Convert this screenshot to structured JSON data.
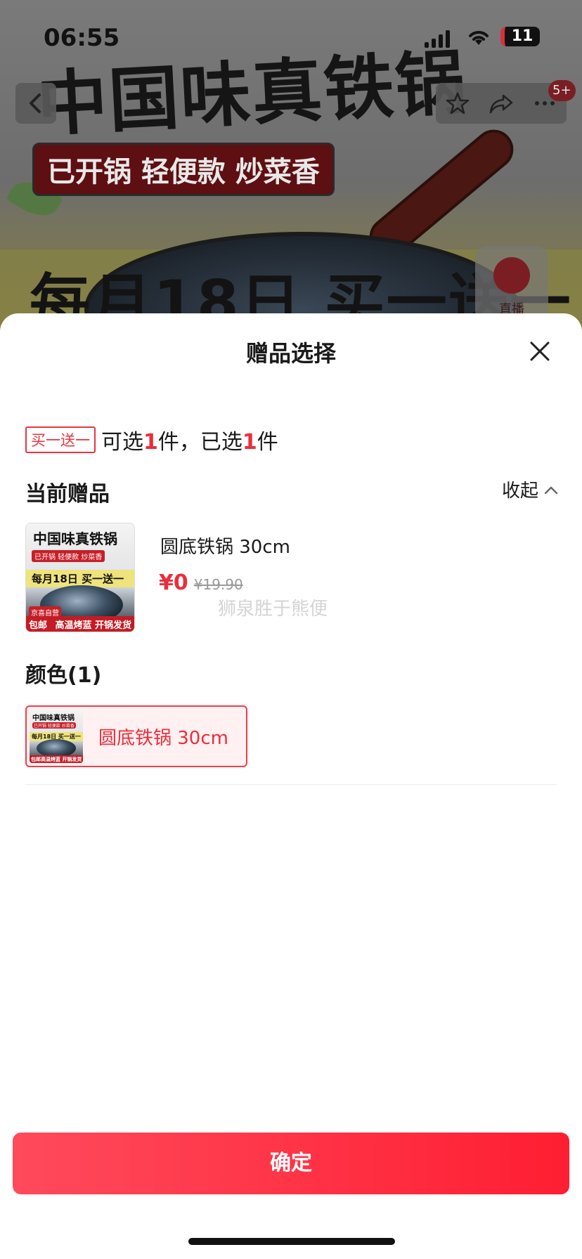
{
  "status_bar": {
    "time": "06:55",
    "battery": "11"
  },
  "background": {
    "hero_title": "中国味真铁锅",
    "hero_tag": "已开锅 轻便款 炒菜香",
    "promo": "每月18日 买一送一",
    "badge": "5+",
    "live_label": "直播"
  },
  "sheet": {
    "title": "赠品选择",
    "gift_tag": "买一送一",
    "gift_info": {
      "prefix": "可选",
      "available": "1",
      "middle": "件，已选",
      "selected": "1",
      "suffix": "件"
    },
    "current_gift_heading": "当前赠品",
    "collapse_label": "收起",
    "product": {
      "name": "圆底铁锅 30cm",
      "price": "¥0",
      "original_price": "¥19.90",
      "thumb": {
        "title": "中国味真铁锅",
        "tag": "已开锅 轻便款 炒菜香",
        "promo": "每月18日 买一送一",
        "corner": "京喜自营",
        "shipping": "包邮",
        "footer": "高温烤蓝 开锅发货"
      }
    },
    "watermark": "狮泉胜于熊便",
    "color_heading": "颜色(1)",
    "color_option": "圆底铁锅 30cm",
    "confirm_label": "确定"
  },
  "colors": {
    "accent": "#ec2d3b",
    "button_start": "#ff4a5c",
    "button_end": "#ff1e32"
  },
  "icons": [
    "back-icon",
    "star-icon",
    "share-icon",
    "more-icon",
    "close-icon",
    "chevron-up-icon",
    "live-icon"
  ]
}
